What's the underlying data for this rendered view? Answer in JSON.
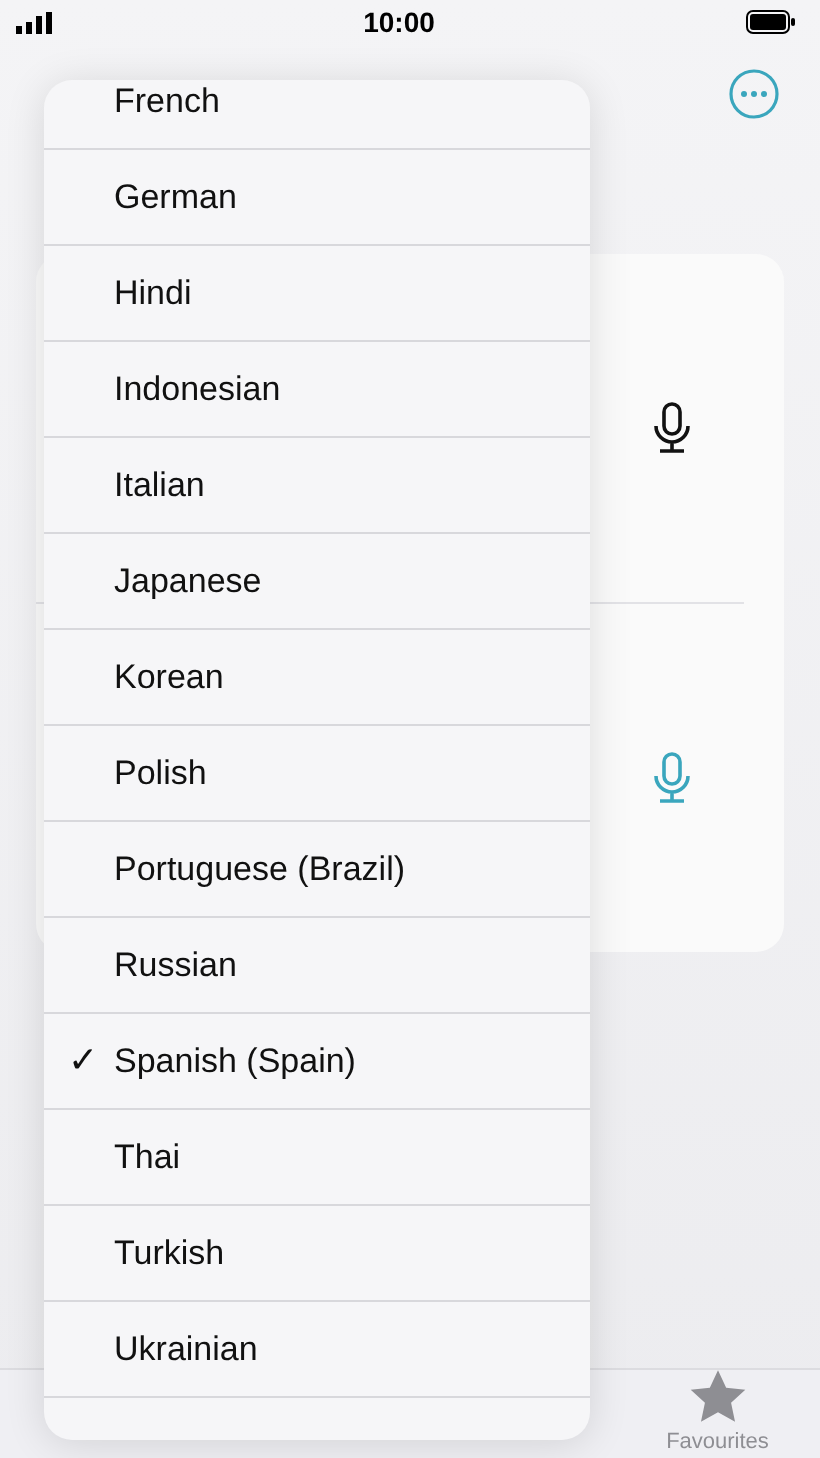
{
  "status_bar": {
    "time": "10:00"
  },
  "language_menu": {
    "items": [
      {
        "label": "French",
        "selected": false
      },
      {
        "label": "German",
        "selected": false
      },
      {
        "label": "Hindi",
        "selected": false
      },
      {
        "label": "Indonesian",
        "selected": false
      },
      {
        "label": "Italian",
        "selected": false
      },
      {
        "label": "Japanese",
        "selected": false
      },
      {
        "label": "Korean",
        "selected": false
      },
      {
        "label": "Polish",
        "selected": false
      },
      {
        "label": "Portuguese (Brazil)",
        "selected": false
      },
      {
        "label": "Russian",
        "selected": false
      },
      {
        "label": "Spanish (Spain)",
        "selected": true
      },
      {
        "label": "Thai",
        "selected": false
      },
      {
        "label": "Turkish",
        "selected": false
      },
      {
        "label": "Ukrainian",
        "selected": false
      }
    ],
    "check": "✓"
  },
  "translation_card": {
    "mics": [
      {
        "kind": "source"
      },
      {
        "kind": "target"
      }
    ]
  },
  "tab_bar": [
    {
      "label": "Favourites",
      "selected": false
    }
  ]
}
